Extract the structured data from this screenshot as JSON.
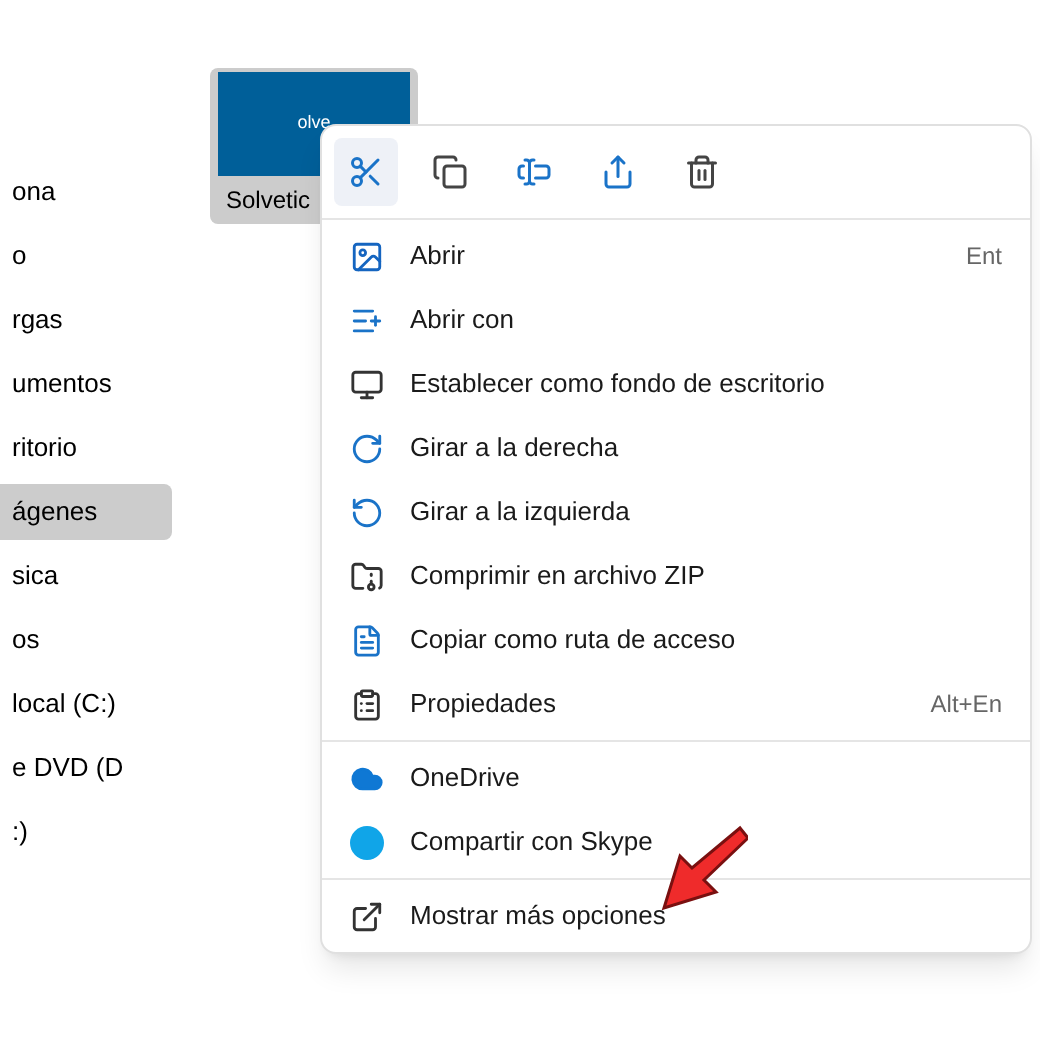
{
  "sidebar": {
    "items": [
      {
        "label": "ona",
        "selected": false
      },
      {
        "label": "o",
        "selected": false
      },
      {
        "label": "rgas",
        "selected": false
      },
      {
        "label": "umentos",
        "selected": false
      },
      {
        "label": "ritorio",
        "selected": false
      },
      {
        "label": "ágenes",
        "selected": true
      },
      {
        "label": "sica",
        "selected": false
      },
      {
        "label": "os",
        "selected": false
      },
      {
        "label": "local (C:)",
        "selected": false
      },
      {
        "label": "e DVD (D",
        "selected": false
      },
      {
        "label": ":)",
        "selected": false
      }
    ]
  },
  "file": {
    "name": "Solvetic",
    "thumbnail_text": "olve",
    "selected": true
  },
  "context_menu": {
    "toolbar": [
      {
        "kind": "cut",
        "hovered": true
      },
      {
        "kind": "copy",
        "hovered": false
      },
      {
        "kind": "rename",
        "hovered": false
      },
      {
        "kind": "share",
        "hovered": false
      },
      {
        "kind": "delete",
        "hovered": false
      }
    ],
    "groups": [
      [
        {
          "kind": "open",
          "label": "Abrir",
          "shortcut": "Ent"
        },
        {
          "kind": "open-with",
          "label": "Abrir con"
        },
        {
          "kind": "wallpaper",
          "label": "Establecer como fondo de escritorio"
        },
        {
          "kind": "rotate-right",
          "label": "Girar a la derecha"
        },
        {
          "kind": "rotate-left",
          "label": "Girar a la izquierda"
        },
        {
          "kind": "zip",
          "label": "Comprimir en archivo ZIP"
        },
        {
          "kind": "path",
          "label": "Copiar como ruta de acceso"
        },
        {
          "kind": "properties",
          "label": "Propiedades",
          "shortcut": "Alt+En"
        }
      ],
      [
        {
          "kind": "onedrive",
          "label": "OneDrive"
        },
        {
          "kind": "skype",
          "label": "Compartir con Skype"
        }
      ],
      [
        {
          "kind": "more",
          "label": "Mostrar más opciones"
        }
      ]
    ]
  }
}
